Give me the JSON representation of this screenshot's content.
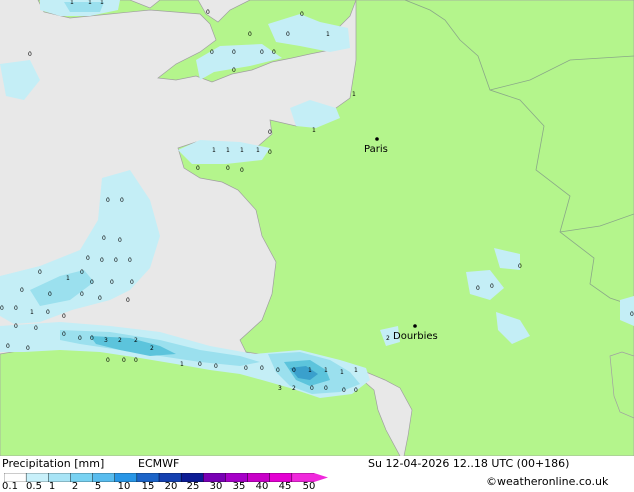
{
  "map": {
    "colors": {
      "sea": "#e8e8e8",
      "land": "#b4f58c",
      "border": "#8aa888",
      "coast": "#a0a0a0",
      "precip_light": "#c4eef6",
      "precip_mid": "#9be0ee",
      "precip_strong": "#5cc4dc",
      "precip_heavy": "#3aa0cc"
    },
    "cities": [
      {
        "label": "Paris"
      },
      {
        "label": "Dourbies"
      }
    ],
    "precip_values": [
      "1",
      "1",
      "1",
      "0",
      "0",
      "1",
      "0",
      "0",
      "0",
      "0",
      "0",
      "0",
      "0",
      "1",
      "1",
      "0",
      "0",
      "1",
      "1",
      "1",
      "1",
      "0",
      "0",
      "0",
      "0",
      "0",
      "0",
      "0",
      "0",
      "0",
      "0",
      "0",
      "0",
      "1",
      "0",
      "0",
      "0",
      "0",
      "0",
      "0",
      "0",
      "0",
      "0",
      "0",
      "0",
      "1",
      "0",
      "0",
      "0",
      "0",
      "0",
      "0",
      "0",
      "0",
      "0",
      "0",
      "0",
      "0",
      "3",
      "2",
      "2",
      "2",
      "1",
      "0",
      "0",
      "0",
      "0",
      "0",
      "0",
      "1",
      "1",
      "1",
      "1",
      "3",
      "2",
      "0",
      "0",
      "0",
      "0",
      "0",
      "0",
      "2",
      "0",
      "0",
      "0"
    ]
  },
  "footer": {
    "title": "Precipitation [mm]",
    "model": "ECMWF",
    "datetime": "Su 12-04-2026 12..18 UTC (00+186)",
    "credit": "©weatheronline.co.uk",
    "legend": {
      "colors": [
        "#fefefe",
        "#c8f0fa",
        "#a8e4f6",
        "#78d2f2",
        "#58bcee",
        "#2896e6",
        "#1c64c8",
        "#1440b0",
        "#0c1c94",
        "#7800b4",
        "#a600c8",
        "#c800c8",
        "#e400d2",
        "#f028dc"
      ],
      "ticks": [
        "0.1",
        "0.5",
        "1",
        "2",
        "5",
        "10",
        "15",
        "20",
        "25",
        "30",
        "35",
        "40",
        "45",
        "50"
      ]
    }
  }
}
